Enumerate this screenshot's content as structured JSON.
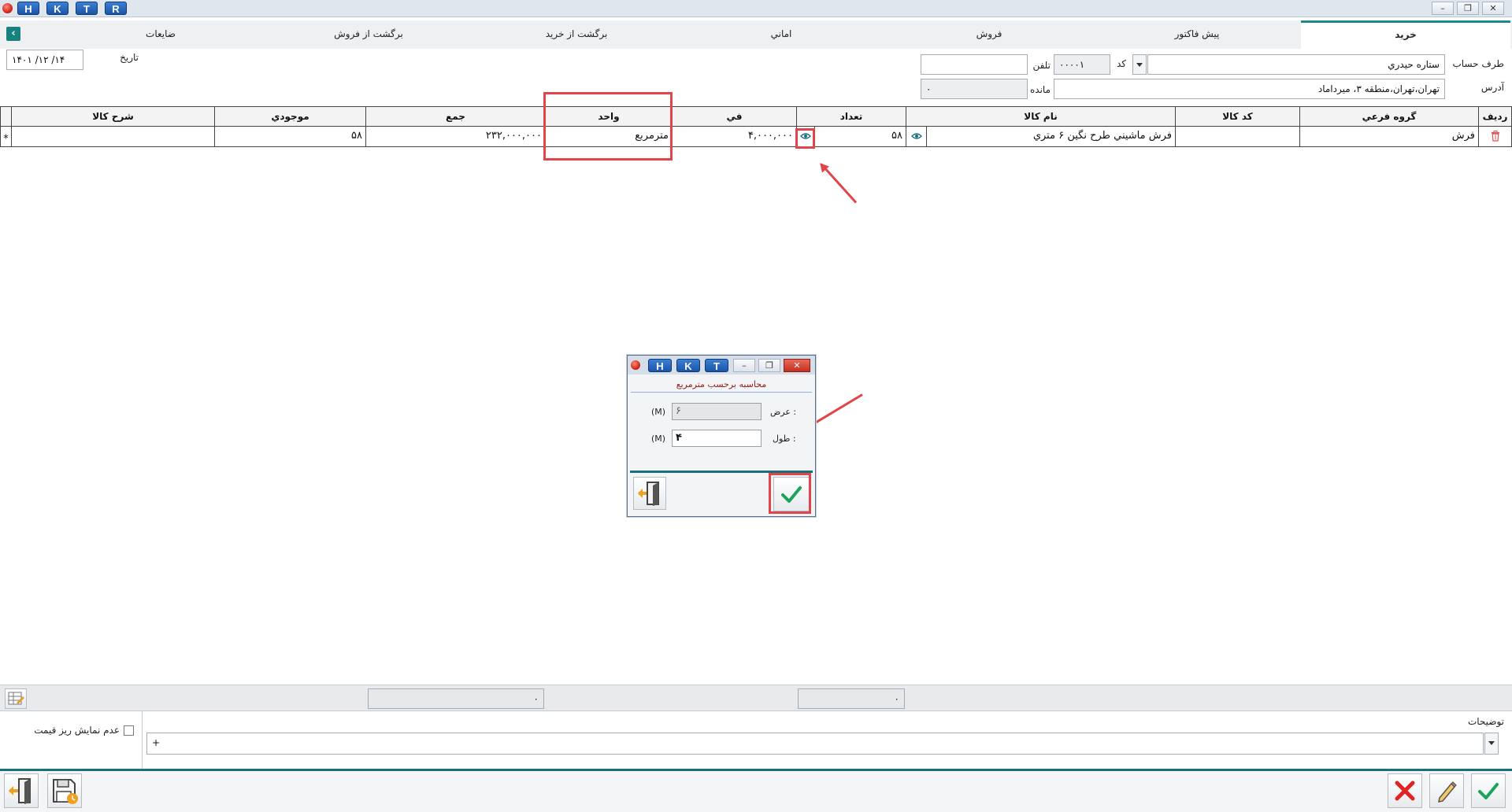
{
  "titlebar": {
    "keys": [
      "H",
      "K",
      "T",
      "R"
    ],
    "minimize": "–",
    "restore": "❐",
    "close": "✕"
  },
  "tabs": [
    "خريد",
    "پيش فاكتور",
    "فروش",
    "اماني",
    "برگشت از خريد",
    "برگشت از فروش",
    "ضايعات"
  ],
  "tab_nav_glyph": "‹",
  "header": {
    "account_label": "طرف حساب",
    "account_value": "ستاره حيدري",
    "code_label": "كد",
    "code_value": "۰۰۰۰۱",
    "phone_label": "تلفن",
    "phone_value": "",
    "address_label": "آدرس",
    "address_value": "تهران،تهران،منطقه ۳، ميرداماد",
    "balance_label": "مانده",
    "balance_value": "۰",
    "date_label": "تاريخ",
    "date_value": "۱۴۰۱ /۱۲ /۱۴"
  },
  "grid": {
    "columns": [
      "رديف",
      "گروه فرعي",
      "كد كالا",
      "نام كالا",
      "تعداد",
      "في",
      "واحد",
      "جمع",
      "موجودي",
      "شرح كالا"
    ],
    "row": {
      "group": "فرش",
      "code": "",
      "name": "فرش ماشيني طرح نگين ۶ متري",
      "qty": "۵۸",
      "price": "۴,۰۰۰,۰۰۰",
      "unit": "مترمربع",
      "total": "۲۳۲,۰۰۰,۰۰۰",
      "stock": "۵۸",
      "desc": ""
    },
    "row_marker": "⁎"
  },
  "dialog": {
    "keys": [
      "H",
      "K",
      "T"
    ],
    "heading": "محاسبه برحسب مترمربع",
    "width_label": "عرض :",
    "width_value": "۶",
    "width_unit": "(M)",
    "length_label": "طول :",
    "length_value": "۴",
    "length_unit": "(M)"
  },
  "summary": {
    "sum1": "۰",
    "sum2": "۰"
  },
  "notes": {
    "label": "توضيحات",
    "value": "+",
    "checkbox_label": "عدم نمايش ريز قيمت",
    "checkbox_checked": false
  },
  "colors": {
    "accent": "#17707a",
    "annotation": "#e0454a",
    "confirm": "#1aa35a",
    "cancel": "#e02424"
  }
}
